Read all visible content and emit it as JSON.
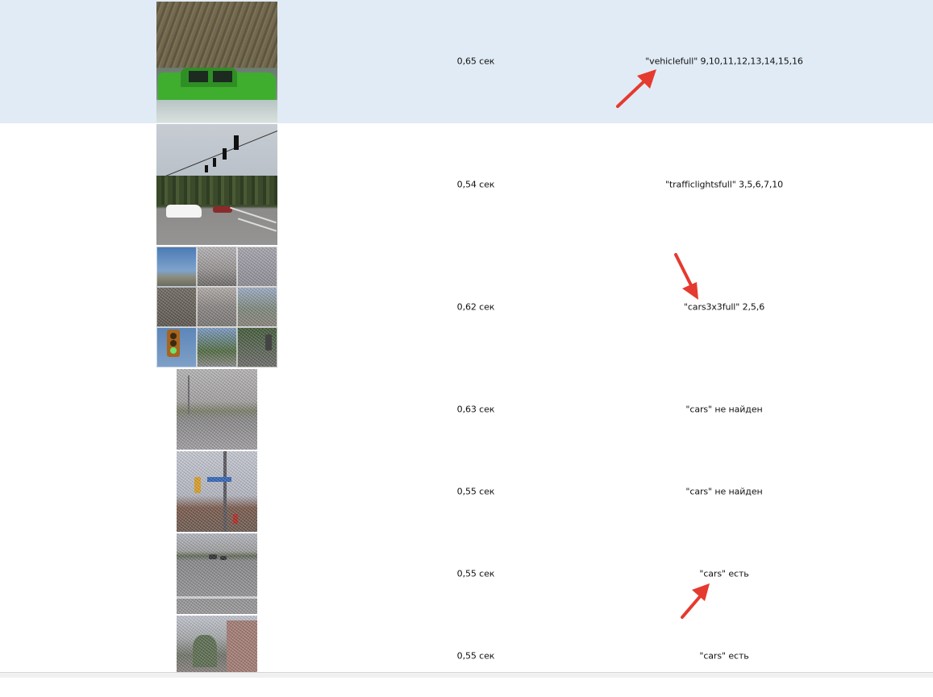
{
  "rows": [
    {
      "time": "0,65 сек",
      "result": "\"vehiclefull\" 9,10,11,12,13,14,15,16",
      "selected": true,
      "thumb": "green-pickup-truck"
    },
    {
      "time": "0,54 сек",
      "result": "\"trafficlightsfull\" 3,5,6,7,10",
      "selected": false,
      "thumb": "intersection-traffic-lights"
    },
    {
      "time": "0,62 сек",
      "result": "\"cars3x3full\" 2,5,6",
      "selected": false,
      "thumb": "3x3-grid-street"
    },
    {
      "time": "0,63 сек",
      "result": "\"cars\" не найден",
      "selected": false,
      "thumb": "noisy-road"
    },
    {
      "time": "0,55 сек",
      "result": "\"cars\" не найден",
      "selected": false,
      "thumb": "street-traffic-light-sign"
    },
    {
      "time": "0,55 сек",
      "result": "\"cars\" есть",
      "selected": false,
      "thumb": "road-with-cars"
    },
    {
      "time": "0,55 сек",
      "result": "\"cars\" есть",
      "selected": false,
      "thumb": "city-street-buildings"
    }
  ],
  "colors": {
    "selected_row": "#e1ebf5",
    "arrow": "#e53a2f"
  }
}
